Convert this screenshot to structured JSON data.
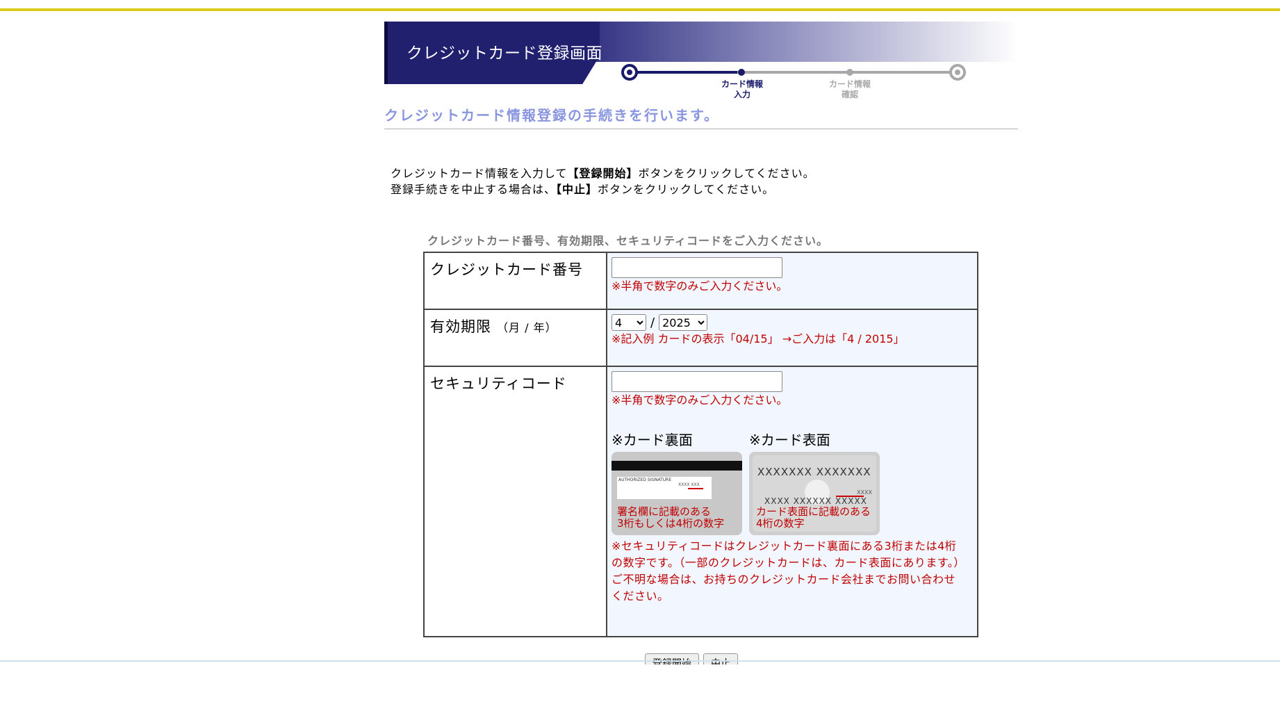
{
  "header": {
    "title": "クレジットカード登録画面"
  },
  "steps": [
    {
      "label": "",
      "state": "start"
    },
    {
      "label": "カード情報\n入力",
      "state": "active"
    },
    {
      "label": "カード情報\n確認",
      "state": "inactive"
    },
    {
      "label": "",
      "state": "end"
    }
  ],
  "subtitle": "クレジットカード情報登録の手続きを行います。",
  "intro": {
    "line1_prefix": "クレジットカード情報を入力して",
    "line1_bold": "【登録開始】",
    "line1_suffix": "ボタンをクリックしてください。",
    "line2_prefix": "登録手続きを中止する場合は、",
    "line2_bold": "【中止】",
    "line2_suffix": "ボタンをクリックしてください。"
  },
  "form_hint": "クレジットカード番号、有効期限、セキュリティコードをご入力ください。",
  "form": {
    "card_number": {
      "label": "クレジットカード番号",
      "value": "",
      "note": "※半角で数字のみご入力ください。"
    },
    "expiry": {
      "label": "有効期限",
      "label_sub": "（月 / 年）",
      "month": "4",
      "separator": "/",
      "year": "2025",
      "note": "※記入例 カードの表示「04/15」 →ご入力は「4 / 2015」"
    },
    "security_code": {
      "label": "セキュリティコード",
      "value": "",
      "note": "※半角で数字のみご入力ください。",
      "back_heading": "※カード裏面",
      "front_heading": "※カード表面",
      "back_card": {
        "sig_text": "AUTHORIZED SIGNATURE",
        "sig_code": "XXXX XXX",
        "note": "署名欄に記載のある\n3桁もしくは4桁の数字"
      },
      "front_card": {
        "line1": "XXXXXXX XXXXXXX",
        "line2": "XXXX XXXXXX XXXXX",
        "code": "XXXX",
        "note": "カード表面に記載のある\n4桁の数字"
      },
      "long_note_1": "※セキュリティコードはクレジットカード裏面にある3桁または4桁の数字です。（一部のクレジットカードは、カード表面にあります。）",
      "long_note_2": "ご不明な場合は、お持ちのクレジットカード会社までお問い合わせください。"
    }
  },
  "buttons": {
    "start": "登録開始",
    "cancel": "中止"
  },
  "colors": {
    "accent_stripe": "#dccb1f",
    "banner_dark": "#1a1a6b",
    "subtitle": "#8a95e0",
    "note_red": "#c00000",
    "field_bg": "#f1f6ff"
  }
}
